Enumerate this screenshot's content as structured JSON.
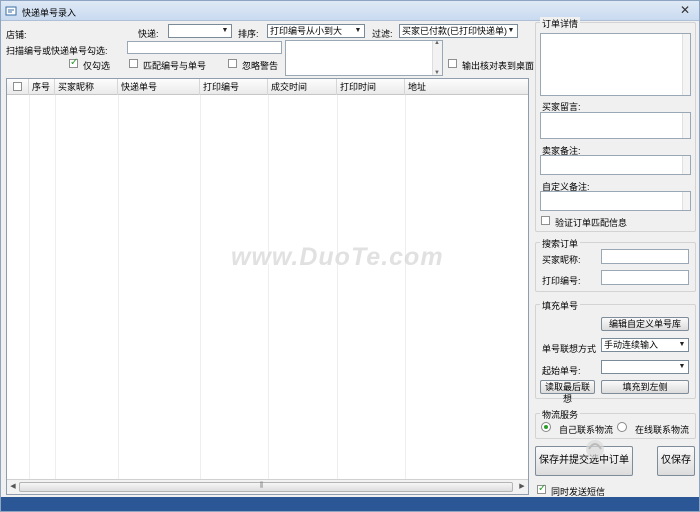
{
  "window": {
    "title": "快递单号录入"
  },
  "toolbar": {
    "shop_label": "店铺:",
    "express_label": "快递:",
    "express_value": "",
    "sort_label": "排序:",
    "sort_value": "打印编号从小到大",
    "filter_label": "过滤:",
    "filter_value": "买家已付款(已打印快递单)",
    "scan_label": "扫描编号或快递单号勾选:",
    "scan_value": "",
    "only_checked": "仅勾选",
    "match_code_and_number": "匹配编号与单号",
    "ignore_warning": "忽略警告",
    "output_to_desktop": "输出核对表到桌面"
  },
  "table": {
    "columns": [
      "序号",
      "买家昵称",
      "快递单号",
      "打印编号",
      "成交时间",
      "打印时间",
      "地址"
    ],
    "rows": []
  },
  "order_details": {
    "title": "订单详情",
    "buyer_message_label": "买家留言:",
    "seller_note_label": "卖家备注:",
    "custom_note_label": "自定义备注:",
    "verify_match_label": "验证订单匹配信息"
  },
  "search": {
    "title": "搜索订单",
    "buyer_nick_label": "买家昵称:",
    "print_no_label": "打印编号:"
  },
  "fill": {
    "title": "填充单号",
    "edit_custom_button": "编辑自定义单号库",
    "assoc_label": "单号联想方式",
    "assoc_value": "手动连续输入",
    "start_label": "起始单号:",
    "start_value": "",
    "read_last_button": "读取最后联想",
    "fill_left_button": "填充到左侧"
  },
  "logistics": {
    "title": "物流服务",
    "self_contact": "自己联系物流",
    "online_contact": "在线联系物流",
    "selected": "self"
  },
  "actions": {
    "save_and_send_button": "保存并提交选中订单",
    "save_only_button": "仅保存",
    "send_sms_label": "同时发送短信"
  },
  "watermark": {
    "text": "www.DuoTe.com"
  },
  "colors": {
    "statusbar": "#2b5797",
    "titlebar": "#c9daf0",
    "check_green": "#2a9d2a"
  }
}
